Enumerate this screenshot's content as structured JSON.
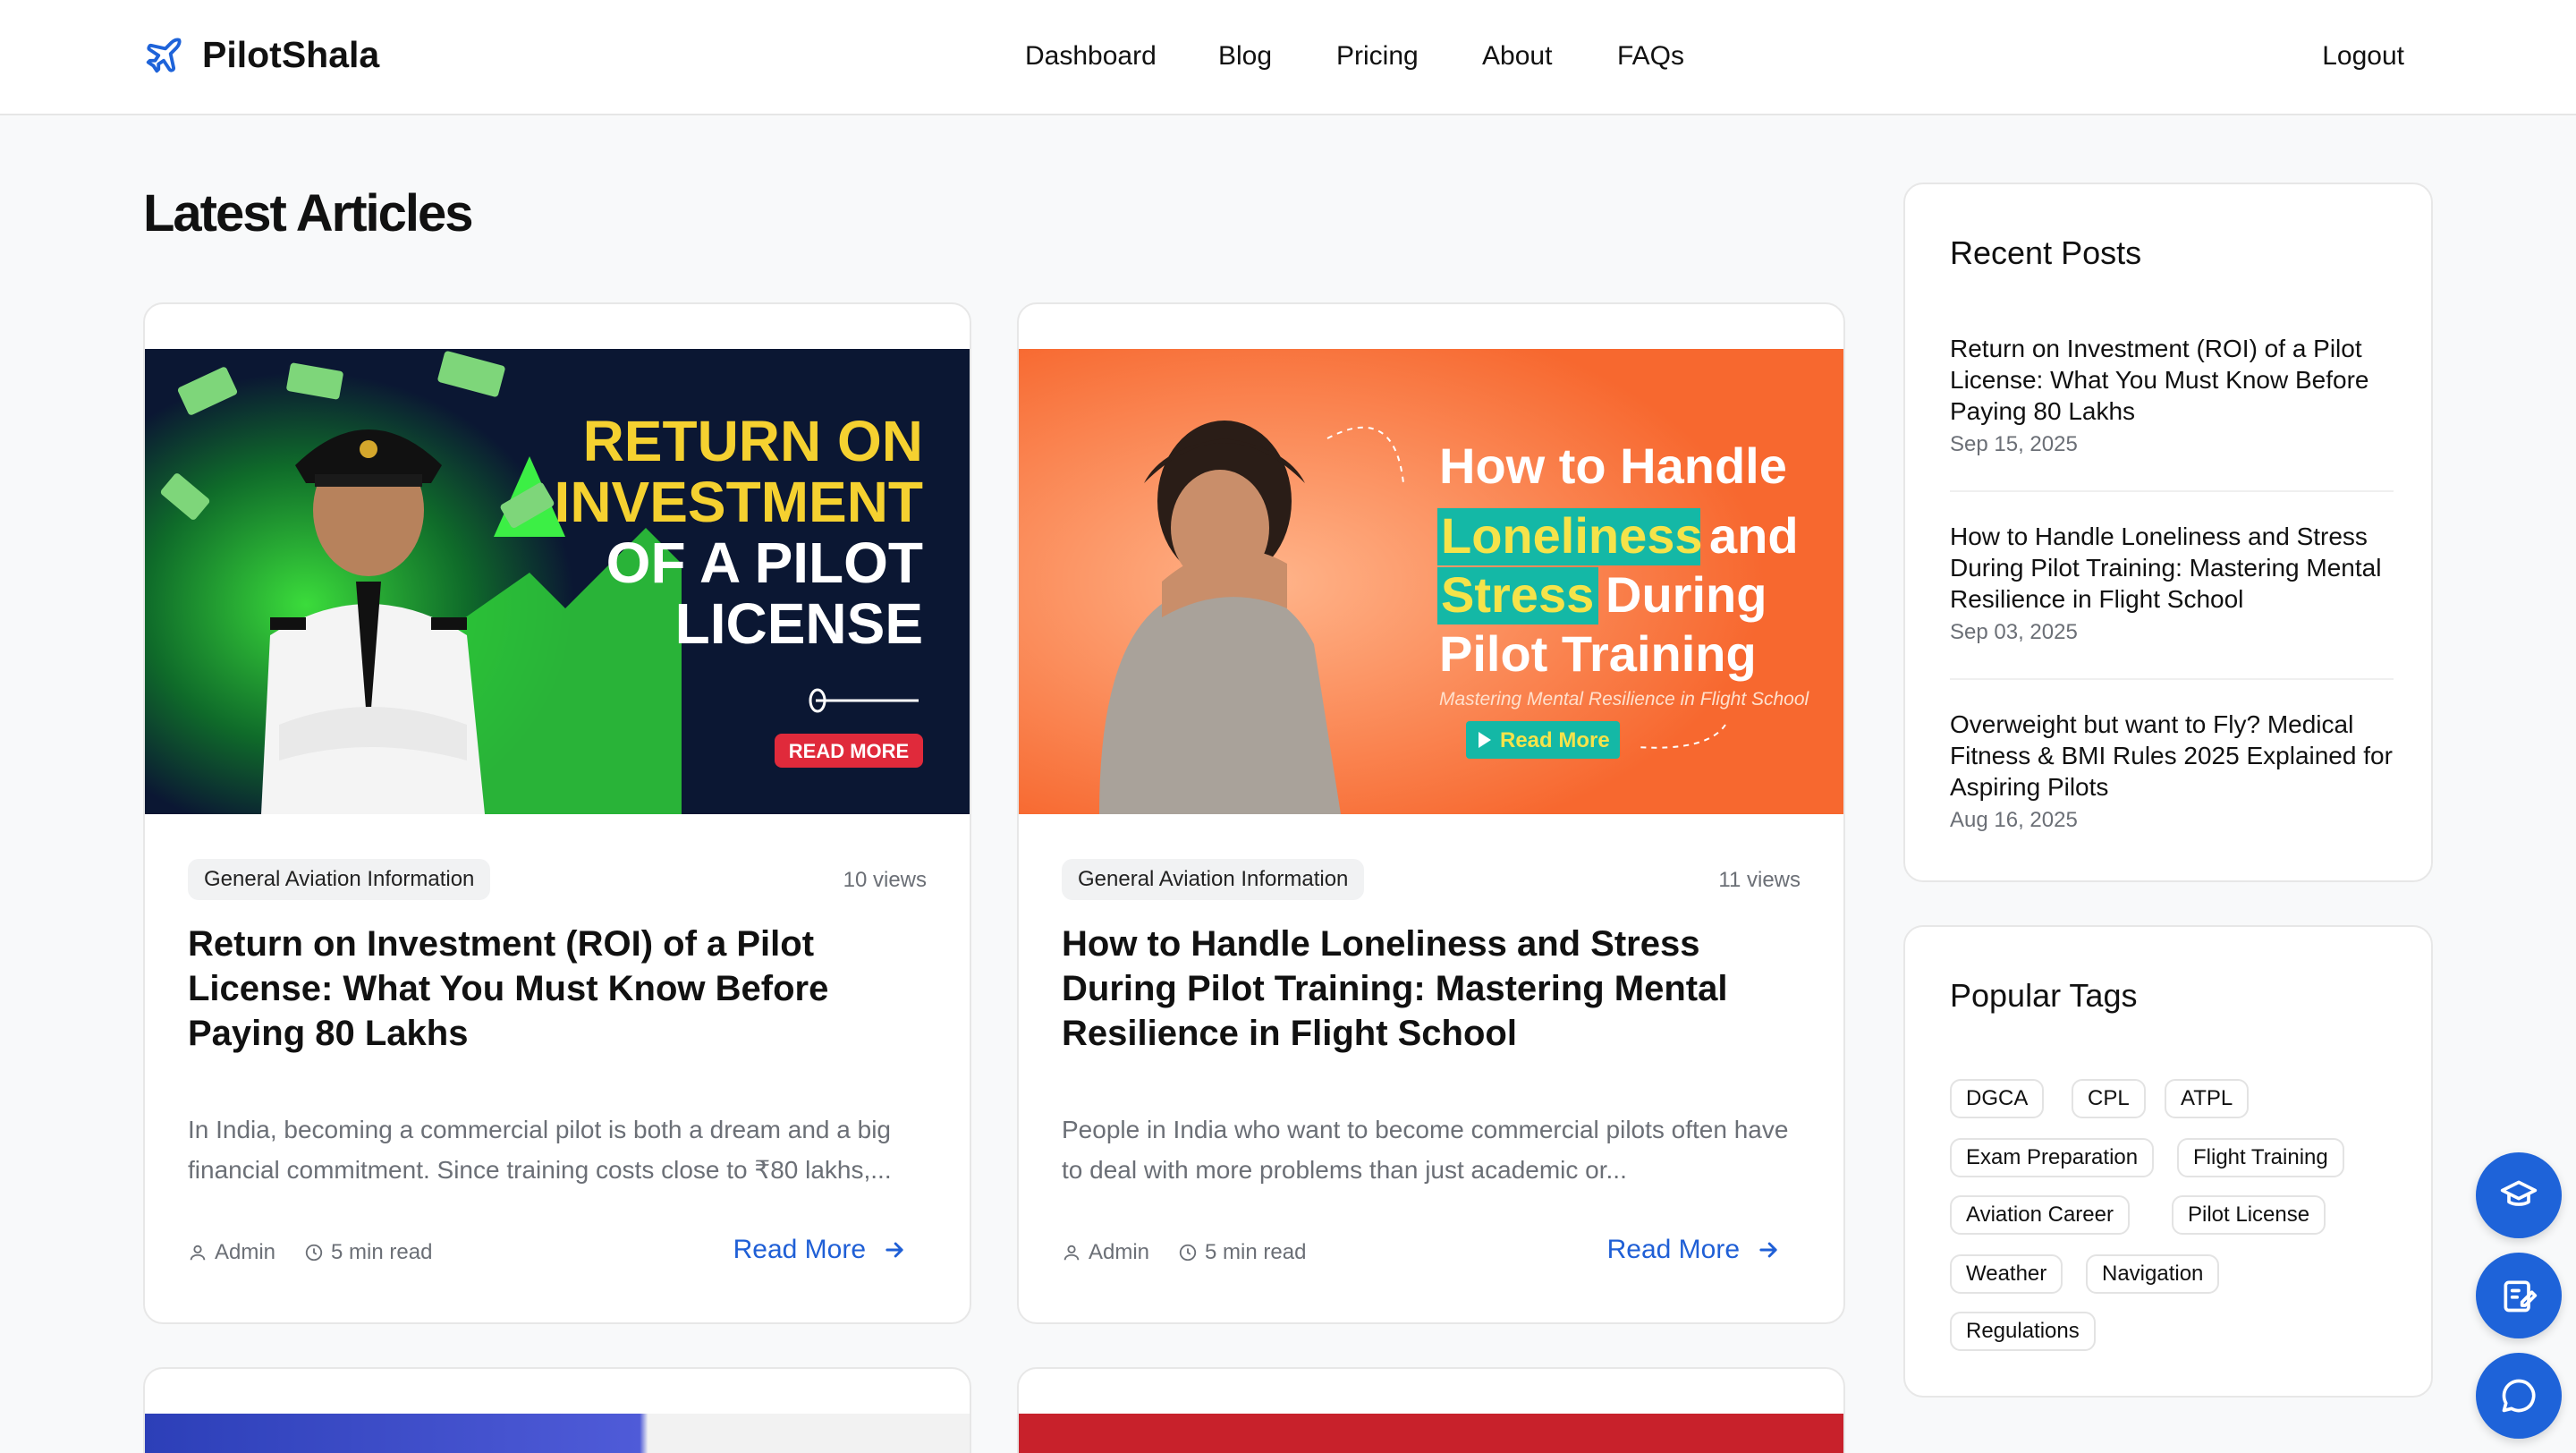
{
  "brand": {
    "name": "PilotShala",
    "accent": "#1e63d9"
  },
  "nav": {
    "items": [
      "Dashboard",
      "Blog",
      "Pricing",
      "About",
      "FAQs"
    ],
    "logout": "Logout"
  },
  "main": {
    "title": "Latest Articles",
    "articles": [
      {
        "category": "General Aviation Information",
        "views": "10 views",
        "title": "Return on Investment (ROI) of a Pilot License: What You Must Know Before Paying 80 Lakhs",
        "excerpt": "In India, becoming a commercial pilot is both a dream and a big financial commitment. Since training costs close to ₹80 lakhs,...",
        "author": "Admin",
        "read_time": "5 min read",
        "read_more": "Read More",
        "image": {
          "line1": "RETURN ON",
          "line2": "INVESTMENT",
          "line3": "OF A PILOT",
          "line4": "LICENSE",
          "button": "READ MORE"
        }
      },
      {
        "category": "General Aviation Information",
        "views": "11 views",
        "title": "How to Handle Loneliness and Stress During Pilot Training: Mastering Mental Resilience in Flight School",
        "excerpt": "People in India who want to become commercial pilots often have to deal with more problems than just academic or...",
        "author": "Admin",
        "read_time": "5 min read",
        "read_more": "Read More",
        "image": {
          "line1": "How to Handle",
          "hl1": "Loneliness",
          "line2b": "and",
          "hl2": "Stress",
          "line3b": "During",
          "line4": "Pilot Training",
          "subtitle": "Mastering Mental Resilience in Flight School",
          "button": "Read More"
        }
      }
    ]
  },
  "sidebar": {
    "recent_title": "Recent Posts",
    "recent_posts": [
      {
        "title": "Return on Investment (ROI) of a Pilot License: What You Must Know Before Paying 80 Lakhs",
        "date": "Sep 15, 2025"
      },
      {
        "title": "How to Handle Loneliness and Stress During Pilot Training: Mastering Mental Resilience in Flight School",
        "date": "Sep 03, 2025"
      },
      {
        "title": "Overweight but want to Fly? Medical Fitness & BMI Rules 2025 Explained for Aspiring Pilots",
        "date": "Aug 16, 2025"
      }
    ],
    "tags_title": "Popular Tags",
    "tags": [
      "DGCA",
      "CPL",
      "ATPL",
      "Exam Preparation",
      "Flight Training",
      "Aviation Career",
      "Pilot License",
      "Weather",
      "Navigation",
      "Regulations"
    ]
  },
  "fabs": [
    "graduation-cap-icon",
    "edit-note-icon",
    "chat-icon"
  ]
}
